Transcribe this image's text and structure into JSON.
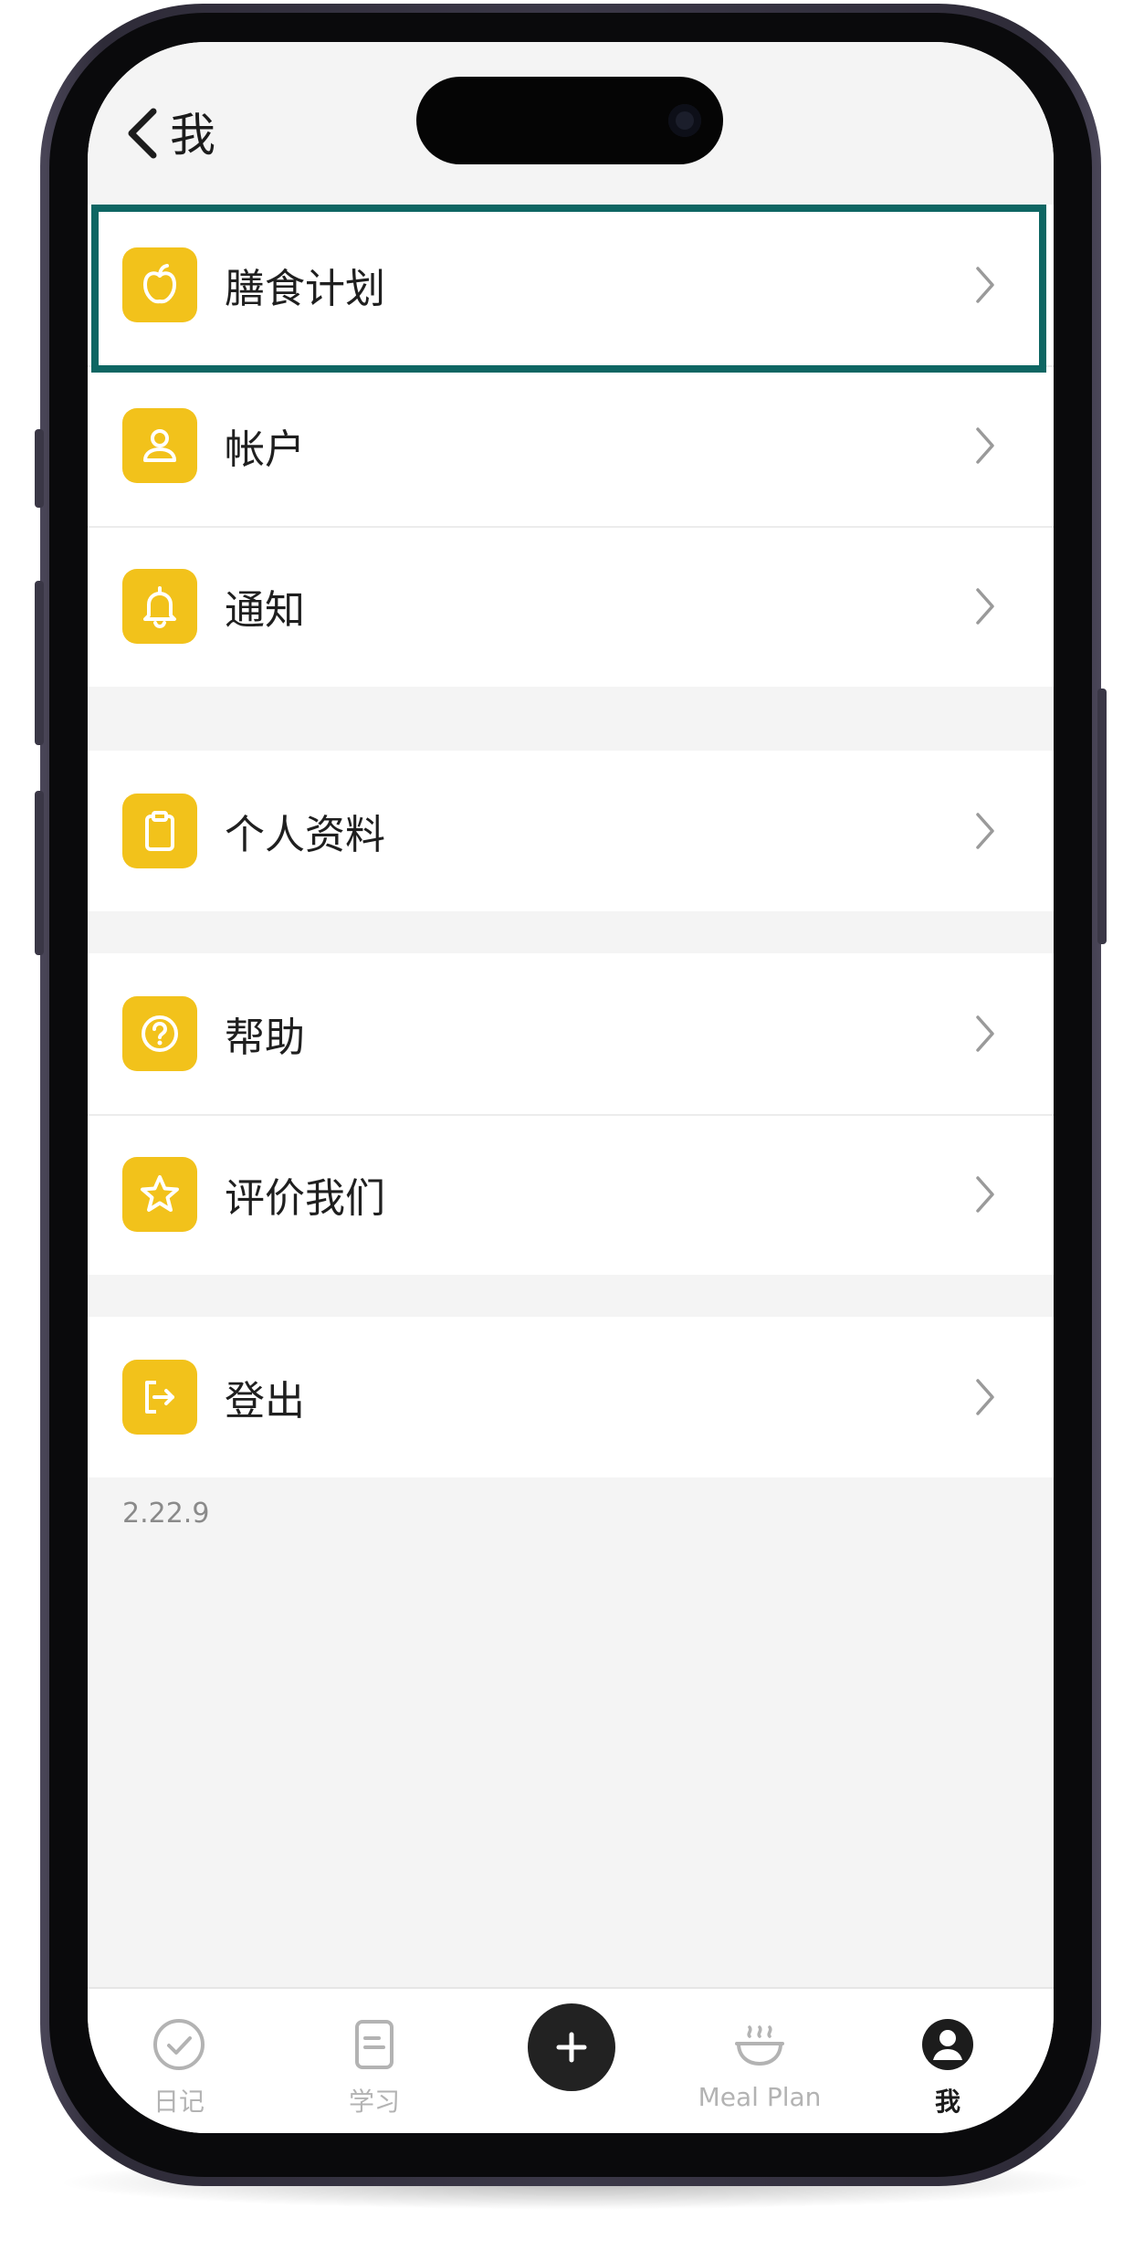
{
  "header": {
    "title": "我"
  },
  "groups": [
    {
      "items": [
        {
          "name": "menu-item-meal-plan",
          "icon": "apple-icon",
          "label": "膳食计划"
        },
        {
          "name": "menu-item-account",
          "icon": "user-icon",
          "label": "帐户"
        },
        {
          "name": "menu-item-notifications",
          "icon": "bell-icon",
          "label": "通知"
        }
      ]
    },
    {
      "items": [
        {
          "name": "menu-item-profile",
          "icon": "clipboard-icon",
          "label": "个人资料"
        }
      ]
    },
    {
      "items": [
        {
          "name": "menu-item-help",
          "icon": "help-circle-icon",
          "label": "帮助"
        },
        {
          "name": "menu-item-rate-us",
          "icon": "star-icon",
          "label": "评价我们"
        }
      ]
    },
    {
      "items": [
        {
          "name": "menu-item-logout",
          "icon": "logout-icon",
          "label": "登出"
        }
      ]
    }
  ],
  "version": "2.22.9",
  "tabbar": {
    "tabs": [
      {
        "icon": "check-circle-icon",
        "label": "日记"
      },
      {
        "icon": "document-icon",
        "label": "学习"
      },
      {
        "icon": "plus-icon",
        "label": ""
      },
      {
        "icon": "bowl-icon",
        "label": "Meal Plan"
      },
      {
        "icon": "user-filled-icon",
        "label": "我"
      }
    ],
    "active_index": 4
  },
  "colors": {
    "accent": "#f2c21b",
    "highlight_border": "#0e6663",
    "background": "#f4f4f4"
  }
}
